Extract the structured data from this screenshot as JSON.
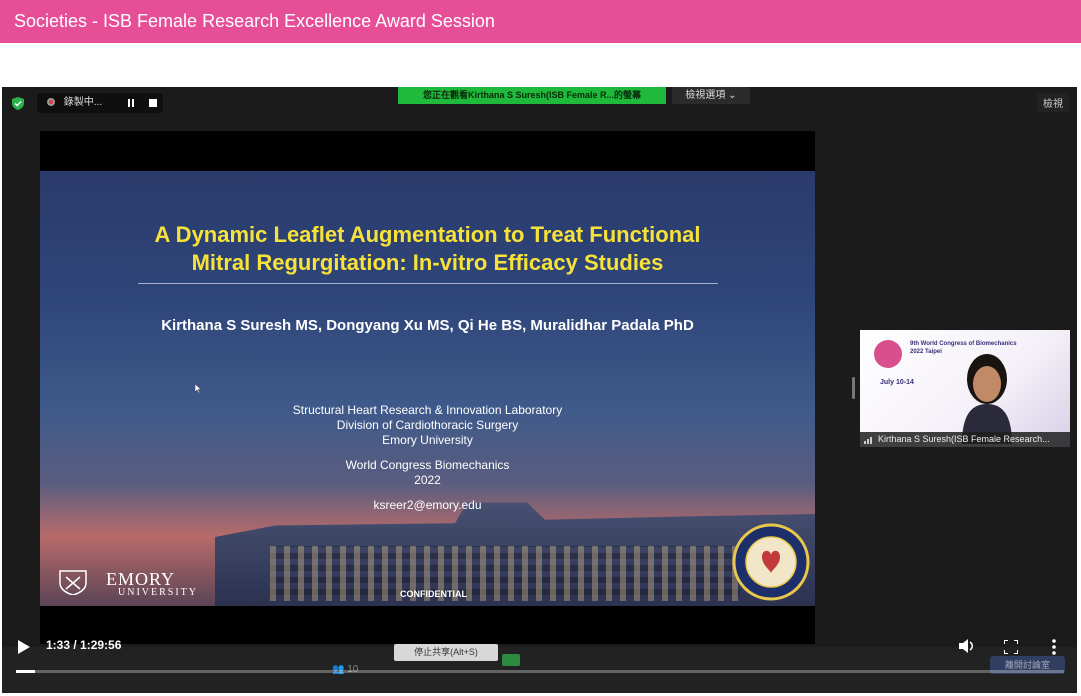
{
  "header": {
    "title": "Societies - ISB Female Research Excellence Award Session"
  },
  "zoom": {
    "recording_label": "錄製中...",
    "viewing_banner": "您正在觀看Kirthana S Suresh(ISB Female R...的螢幕",
    "view_options": "檢視選項 ⌄",
    "view_button": "檢視"
  },
  "slide": {
    "title_line1": "A Dynamic Leaflet Augmentation to Treat Functional",
    "title_line2": "Mitral Regurgitation: In-vitro Efficacy Studies",
    "authors": "Kirthana S Suresh MS, Dongyang Xu MS, Qi He BS, Muralidhar Padala PhD",
    "lab_lines": [
      "Structural Heart Research & Innovation Laboratory",
      "Division of Cardiothoracic Surgery",
      "Emory University"
    ],
    "congress_lines": [
      "World Congress Biomechanics",
      "2022"
    ],
    "email": "ksreer2@emory.edu",
    "logo_name": "EMORY",
    "logo_sub": "UNIVERSITY",
    "confidential": "CONFIDENTIAL"
  },
  "thumbnail": {
    "congress_title": "9th World Congress of Biomechanics 2022 Taipei",
    "congress_date": "July 10-14",
    "participant_name": "Kirthana S Suresh(ISB Female Research..."
  },
  "zoom_toolbar": {
    "participants_count": "10",
    "tooltip": "停止共享(Alt+S)",
    "end_button": "離開討論室"
  },
  "player": {
    "time": "1:33 / 1:29:56",
    "progress": 0.018
  },
  "colors": {
    "header_bg": "#e64f97",
    "title_yellow": "#f7e23a",
    "banner_green": "#1fba3b"
  }
}
